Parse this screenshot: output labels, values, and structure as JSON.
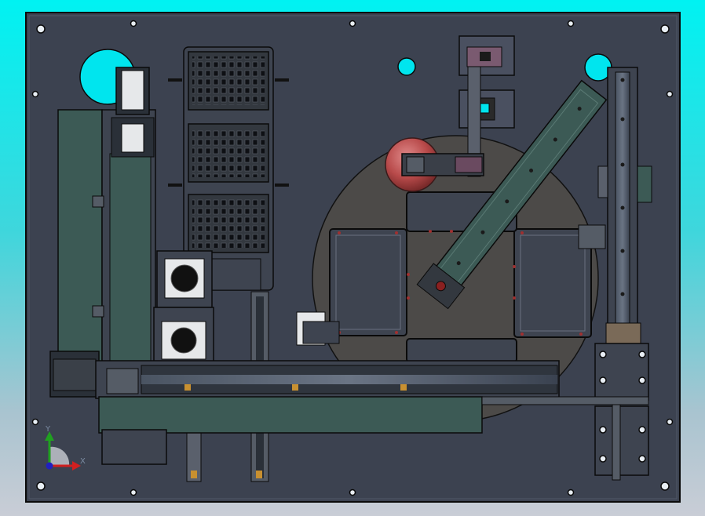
{
  "triad": {
    "x_label": "X",
    "y_label": "Y",
    "x_color": "#d02020",
    "y_color": "#20a020",
    "origin_color": "#2020c0"
  },
  "colors": {
    "background_top": "#00f2f2",
    "background_bottom": "#c9cdd6",
    "base_plate": "#3c4250",
    "edges": "#0a0a0a",
    "hole_cyan": "#00e5ee",
    "dark_steel": "#2a3038",
    "green_steel": "#3c5a55",
    "ball_red": "#c05050"
  },
  "view": {
    "type": "cad-assembly-top-view",
    "trays": 3,
    "tray_pockets_per_row": 9,
    "tray_pocket_rows": 6,
    "turntable_nests": 4
  }
}
